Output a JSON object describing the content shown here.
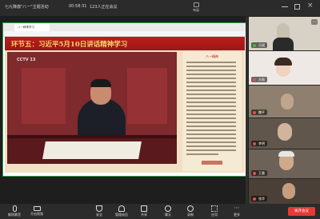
{
  "titlebar": {
    "meeting_title": "七九降旗\"八一\"主题活动",
    "timer": "00:58:31",
    "participants": "123人正在会议",
    "buttons": [
      {
        "icon": "layout-icon",
        "label": "布局"
      },
      {
        "icon": "minimize-icon",
        "label": ""
      },
      {
        "icon": "window-icon",
        "label": ""
      },
      {
        "icon": "close-icon",
        "label": ""
      }
    ]
  },
  "share": {
    "browser_tab": "八一精神学习",
    "slide_heading": "环节五：习近平5月10日讲话精神学习",
    "cctv_logo": "CCTV 13",
    "panel_title": "八一精神"
  },
  "participants": [
    {
      "name": "吕斌",
      "avatar_color": "#c8c0b0",
      "bg": "#d8d2c6"
    },
    {
      "name": "方雨",
      "avatar_color": "#e5e5e5",
      "bg": "#eee9e5"
    },
    {
      "name": "魏平",
      "avatar_color": "#bfa58c",
      "bg": "#8e7f6e"
    },
    {
      "name": "李明",
      "avatar_color": "#d2b39b",
      "bg": "#60564c"
    },
    {
      "name": "王晨",
      "avatar_color": "#cfa98a",
      "bg": "#6d6258"
    },
    {
      "name": "张华",
      "avatar_color": "#c79e7d",
      "bg": "#4b4038"
    }
  ],
  "toolbar": {
    "items": [
      {
        "icon": "mic-icon",
        "label": "解除静音"
      },
      {
        "icon": "camera-icon",
        "label": "开启视频"
      },
      {
        "icon": "security-icon",
        "label": "安全"
      },
      {
        "icon": "members-icon",
        "label": "管理成员"
      },
      {
        "icon": "share-icon",
        "label": "共享"
      },
      {
        "icon": "chat-icon",
        "label": "聊天"
      },
      {
        "icon": "record-icon",
        "label": "录制"
      },
      {
        "icon": "apps-icon",
        "label": "应用"
      },
      {
        "icon": "more-icon",
        "label": "更多"
      }
    ],
    "leave_label": "离开会议",
    "leave_color": "#e53935"
  },
  "colors": {
    "accent": "#2ea043",
    "banner": "#b81d1d"
  }
}
